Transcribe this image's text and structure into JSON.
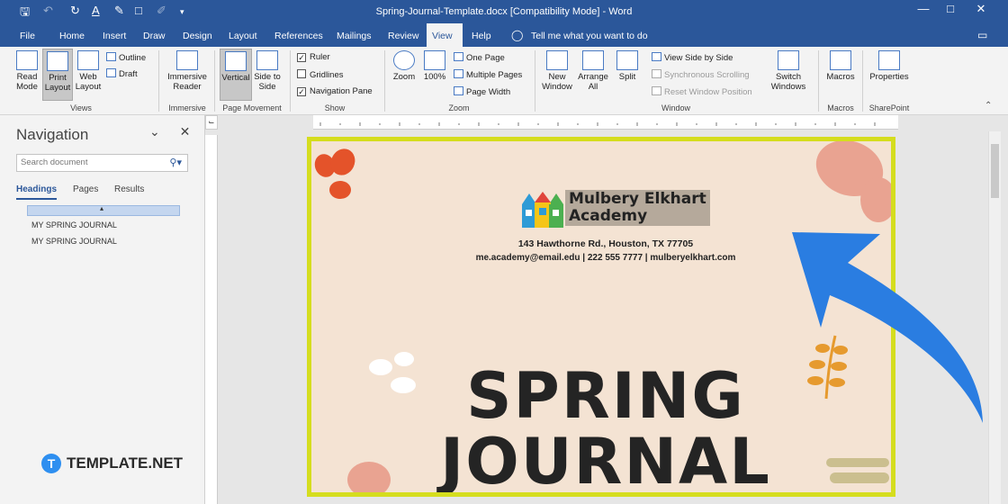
{
  "window": {
    "title": "Spring-Journal-Template.docx [Compatibility Mode] - Word"
  },
  "menu": {
    "tabs": [
      "File",
      "Home",
      "Insert",
      "Draw",
      "Design",
      "Layout",
      "References",
      "Mailings",
      "Review",
      "View",
      "Help"
    ],
    "active": "View",
    "tell_me": "Tell me what you want to do"
  },
  "ribbon": {
    "views": {
      "read_mode": "Read Mode",
      "print_layout": "Print Layout",
      "web_layout": "Web Layout",
      "outline": "Outline",
      "draft": "Draft",
      "label": "Views"
    },
    "immersive": {
      "immersive_reader": "Immersive Reader",
      "label": "Immersive"
    },
    "page_movement": {
      "vertical": "Vertical",
      "side_to_side": "Side to Side",
      "label": "Page Movement"
    },
    "show": {
      "ruler": "Ruler",
      "gridlines": "Gridlines",
      "navigation_pane": "Navigation Pane",
      "label": "Show",
      "ruler_checked": true,
      "gridlines_checked": false,
      "navigation_pane_checked": true
    },
    "zoom": {
      "zoom": "Zoom",
      "hundred": "100%",
      "one_page": "One Page",
      "multiple_pages": "Multiple Pages",
      "page_width": "Page Width",
      "label": "Zoom"
    },
    "window": {
      "new_window": "New Window",
      "arrange_all": "Arrange All",
      "split": "Split",
      "view_side_by_side": "View Side by Side",
      "sync_scrolling": "Synchronous Scrolling",
      "reset_window_position": "Reset Window Position",
      "switch_windows": "Switch Windows",
      "label": "Window"
    },
    "macros": {
      "macros": "Macros",
      "label": "Macros"
    },
    "sharepoint": {
      "properties": "Properties",
      "label": "SharePoint"
    }
  },
  "navigation": {
    "title": "Navigation",
    "search_placeholder": "Search document",
    "tabs": [
      "Headings",
      "Pages",
      "Results"
    ],
    "active_tab": "Headings",
    "headings": [
      "MY SPRING JOURNAL",
      "MY SPRING JOURNAL"
    ]
  },
  "document": {
    "academy_name_line1": "Mulbery Elkhart",
    "academy_name_line2": "Academy",
    "address": "143 Hawthorne Rd., Houston, TX 77705",
    "contact": "me.academy@email.edu  |  222  555  7777  |  mulberyelkhart.com",
    "title_line1": "SPRING",
    "title_line2": "JOURNAL"
  },
  "watermark": {
    "text": "TEMPLATE.NET",
    "icon_letter": "T"
  },
  "colors": {
    "word_blue": "#2b579a",
    "page_bg": "#f4e3d3",
    "highlight_border": "#d5dd1e",
    "arrow": "#2a7de1"
  }
}
